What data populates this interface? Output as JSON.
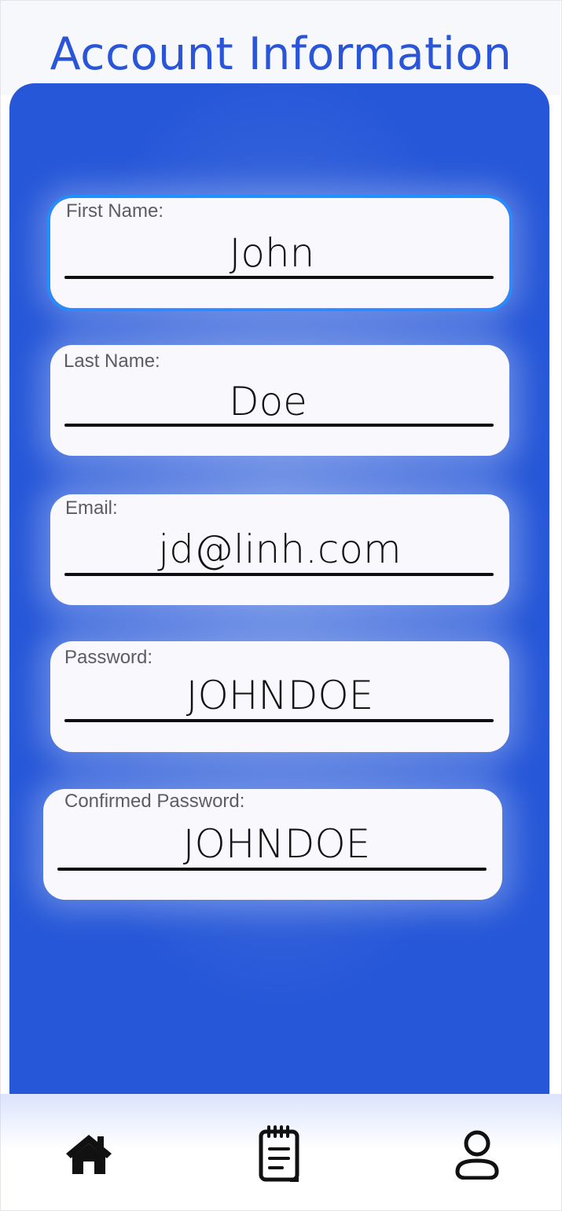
{
  "header": {
    "title": "Account Information"
  },
  "form": {
    "first_name": {
      "label": "First Name:",
      "value": "John"
    },
    "last_name": {
      "label": "Last Name:",
      "value": "Doe"
    },
    "email": {
      "label": "Email:",
      "value": "jd@linh.com"
    },
    "password": {
      "label": "Password:",
      "value": "JOHNDOE"
    },
    "confirm_password": {
      "label": "Confirmed Password:",
      "value": "JOHNDOE"
    }
  },
  "bottom_nav": {
    "items": [
      {
        "icon": "home-icon"
      },
      {
        "icon": "notepad-icon"
      },
      {
        "icon": "user-icon"
      }
    ]
  },
  "colors": {
    "title": "#2a55d8",
    "panel": "#2657d8",
    "card": "#f8f8fd",
    "focus_outline": "#1e90ff"
  }
}
